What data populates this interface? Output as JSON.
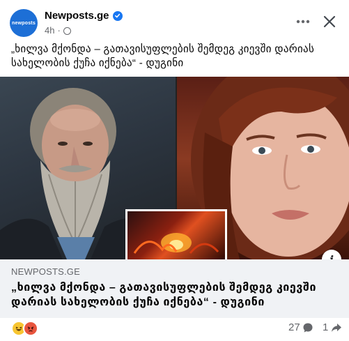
{
  "post": {
    "page_name": "Newposts.ge",
    "avatar_text": "newposts",
    "time": "4h",
    "separator": "·",
    "caption": "„ხილვა მქონდა – გათავისუფლების შემდეგ კიევში დარიას სახელობის ქუჩა იქნება“ - დუგინი"
  },
  "link_preview": {
    "domain": "NEWPOSTS.GE",
    "title": "„ხილვა მქონდა – გათავისუფლების შემდეგ კიევში დარიას სახელობის ქუჩა იქნება“ - დუგინი"
  },
  "footer": {
    "comment_count": "27",
    "share_count": "1"
  },
  "icons": {
    "verified": "verified-badge-icon",
    "privacy": "globe-icon",
    "more": "more-options-icon",
    "close": "close-icon",
    "info": "info-icon",
    "comment": "comment-icon",
    "share": "share-icon"
  },
  "colors": {
    "brand_blue": "#1877f2",
    "avatar_blue": "#1d6fd6",
    "secondary_text": "#65676b",
    "preview_bg": "#f0f2f5"
  }
}
